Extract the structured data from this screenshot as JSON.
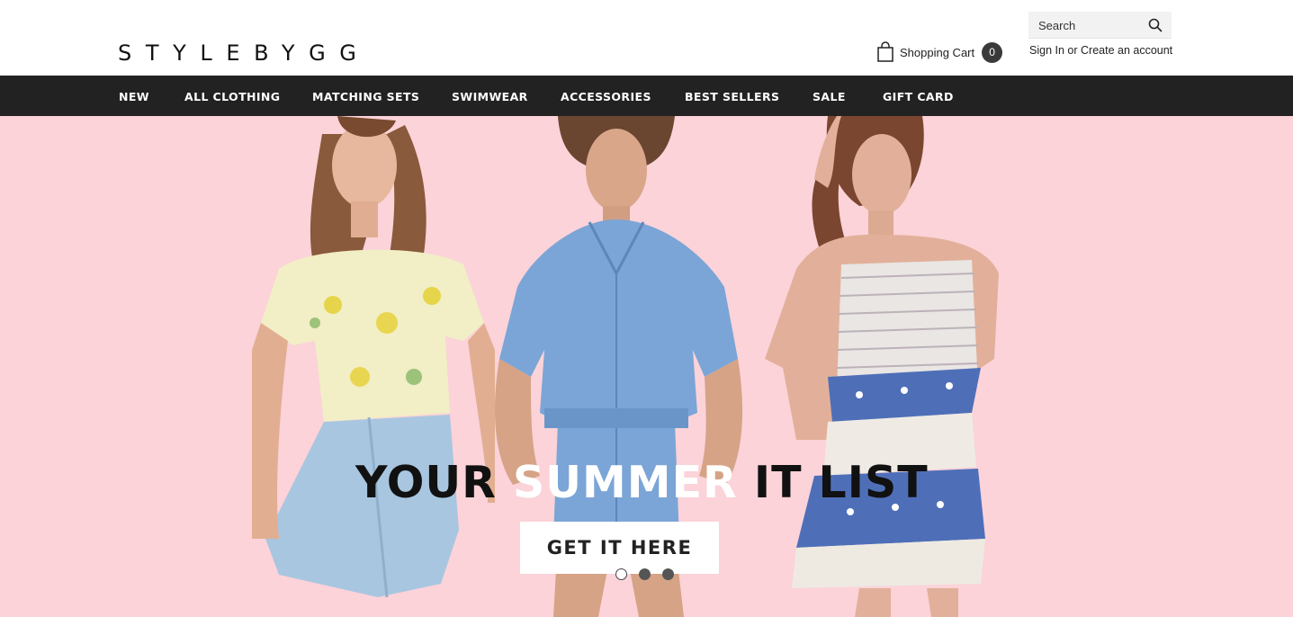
{
  "header": {
    "logo": "STYLEBYGG",
    "search": {
      "placeholder": "Search"
    },
    "cart": {
      "label": "Shopping Cart",
      "count": "0"
    },
    "account": {
      "sign_in": "Sign In",
      "separator": "or",
      "create": "Create an account"
    }
  },
  "nav": {
    "items": [
      "NEW",
      "ALL CLOTHING",
      "MATCHING SETS",
      "SWIMWEAR",
      "ACCESSORIES",
      "BEST SELLERS",
      "SALE",
      "GIFT CARD"
    ]
  },
  "hero": {
    "headline": {
      "part1": "YOUR ",
      "highlight": "SUMMER",
      "part2": " IT LIST"
    },
    "cta": "GET IT HERE",
    "slides": 3,
    "active_slide": 1
  },
  "colors": {
    "nav_bg": "#222222",
    "hero_bg": "#fbd3d9",
    "highlight": "#ffffff"
  }
}
